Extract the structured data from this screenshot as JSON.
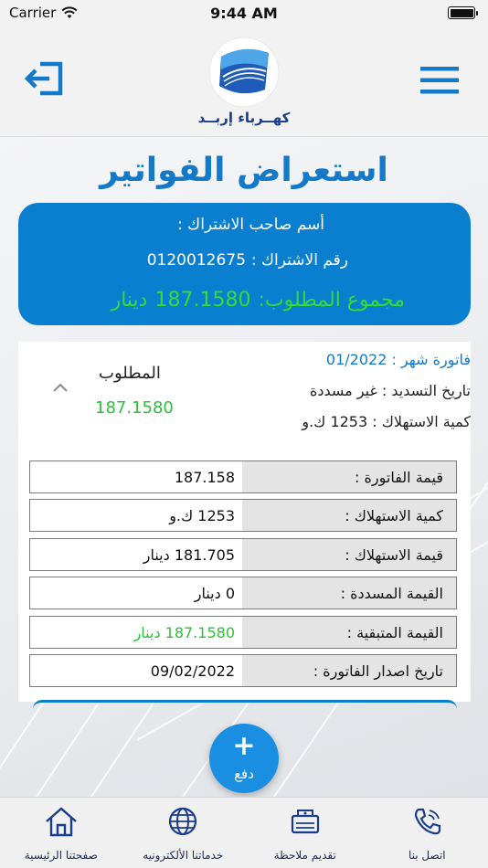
{
  "status_bar": {
    "carrier": "Carrier",
    "time": "9:44 AM"
  },
  "header": {
    "logo_text": "كهــرباء إربــد",
    "exit_icon": "logout-icon",
    "menu_icon": "hamburger-menu-icon"
  },
  "page": {
    "title": "استعراض الفواتير"
  },
  "summary": {
    "subscriber_label": "أسم صاحب الاشتراك :",
    "account_label": "رقم الاشتراك  :",
    "account_number": "0120012675",
    "total_label": "مجموع المطلوب:",
    "total_amount": "187.1580",
    "total_currency": "دينار"
  },
  "bill": {
    "month": "فاتورة شهر : 01/2022",
    "payment_date": "تاريخ التسديد : غير مسددة",
    "consumption": "كمية الاستهلاك : 1253 ك.و",
    "required_label": "المطلوب",
    "required_value": "187.1580",
    "details": [
      {
        "label": "قيمة الفاتورة :",
        "value": "187.158"
      },
      {
        "label": "كمية الاستهلاك :",
        "value": "1253 ك.و"
      },
      {
        "label": "قيمة الاستهلاك :",
        "value": "181.705 دينار"
      },
      {
        "label": "القيمة المسددة :",
        "value": "0 دينار"
      },
      {
        "label": "القيمة المتبقية :",
        "value": "187.1580 دينار"
      },
      {
        "label": "تاريخ اصدار الفاتورة :",
        "value": "09/02/2022"
      }
    ]
  },
  "fab": {
    "plus": "+",
    "label": "دفع"
  },
  "bottom_nav": [
    {
      "label": "صفحتنا الرئيسية",
      "icon": "home-icon"
    },
    {
      "label": "خدماتنا الألكترونيه",
      "icon": "globe-icon"
    },
    {
      "label": "تقديم ملاحظة",
      "icon": "feedback-box-icon"
    },
    {
      "label": "اتصل بنا",
      "icon": "phone-icon"
    }
  ],
  "colors": {
    "brand_blue": "#1479c9",
    "card_blue": "#0a7fcf",
    "green": "#2fbf3a",
    "nav_navy": "#1a3c8c"
  }
}
